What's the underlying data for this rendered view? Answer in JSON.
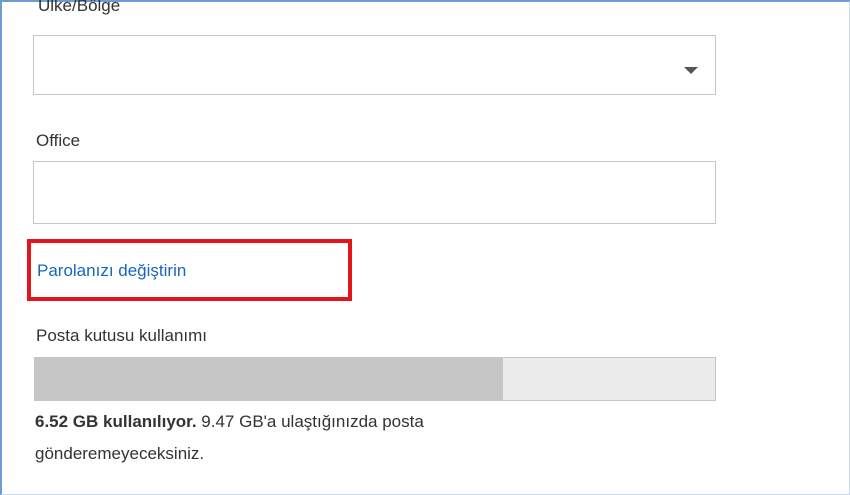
{
  "form": {
    "country_label": "Ülke/Bölge",
    "country_value": "",
    "office_label": "Office",
    "office_value": "",
    "change_password_link": "Parolanızı değiştirin"
  },
  "mailbox": {
    "label": "Posta kutusu kullanımı",
    "used_text": "6.52 GB kullanılıyor.",
    "limit_text": " 9.47 GB'a ulaştığınızda posta gönderemeyeceksiniz.",
    "used_fraction": 0.6885
  },
  "colors": {
    "link": "#1566c0",
    "highlight_box": "#e4141b",
    "bar_fill": "#c6c6c6",
    "bar_track": "#ececec"
  }
}
